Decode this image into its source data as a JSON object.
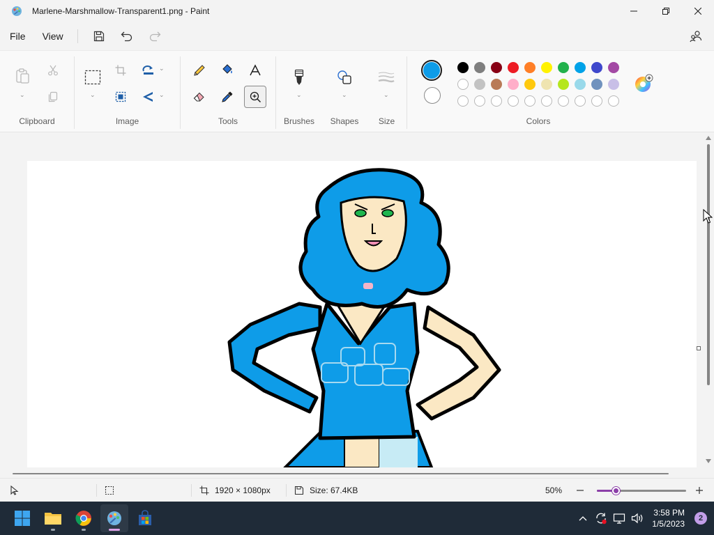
{
  "window": {
    "title": "Marlene-Marshmallow-Transparent1.png - Paint",
    "minimize_icon": "minimize-icon",
    "maximize_icon": "restore-icon",
    "close_icon": "close-icon"
  },
  "menu": {
    "file": "File",
    "view": "View"
  },
  "ribbon": {
    "groups": {
      "clipboard": "Clipboard",
      "image": "Image",
      "tools": "Tools",
      "brushes": "Brushes",
      "shapes": "Shapes",
      "size": "Size",
      "colors": "Colors"
    }
  },
  "colors": {
    "primary": "#0e9ce8",
    "secondary": "#ffffff",
    "accent": "#8b3fa8",
    "palette_row1": [
      "#000000",
      "#7f7f7f",
      "#880015",
      "#ed1c24",
      "#ff7f27",
      "#fff200",
      "#22b14c",
      "#00a2e8",
      "#3f48cc",
      "#a349a4"
    ],
    "palette_row2": [
      "#ffffff",
      "#c3c3c3",
      "#b97a57",
      "#ffaec9",
      "#ffc90e",
      "#efe4b0",
      "#b5e61d",
      "#99d9ea",
      "#7092be",
      "#c8bfe7"
    ],
    "palette_row3_empty": 10
  },
  "status": {
    "dimensions": "1920 × 1080px",
    "size": "Size: 67.4KB",
    "zoom": "50%",
    "zoom_level": 0.22
  },
  "taskbar": {
    "time": "3:58 PM",
    "date": "1/5/2023",
    "notifications": "2"
  }
}
